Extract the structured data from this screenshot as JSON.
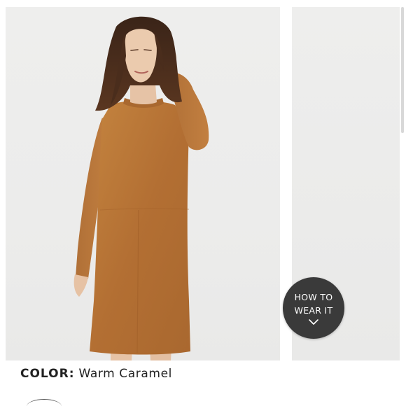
{
  "product_gallery": {
    "main_image_alt": "Model wearing a warm caramel suede-front sweater dress",
    "how_to_wear": {
      "line1": "HOW TO",
      "line2": "WEAR IT",
      "icon": "chevron-down-icon"
    }
  },
  "product_details": {
    "color_label": "COLOR:",
    "color_value": "Warm Caramel"
  },
  "colors": {
    "dress": "#b6763b",
    "background": "#ededec",
    "button_bg": "#3a3a3a",
    "text": "#222222"
  }
}
